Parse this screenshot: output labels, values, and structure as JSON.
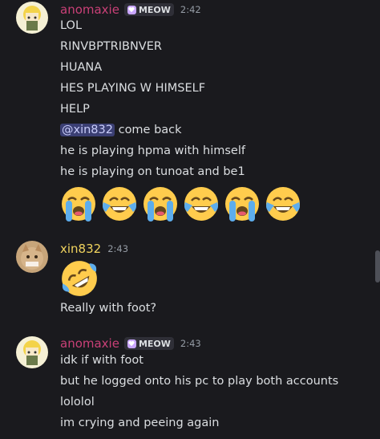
{
  "colors": {
    "anomaxie": "#c94077",
    "xin": "#f0d35e",
    "mention_bg": "#3b3f73"
  },
  "messages": [
    {
      "user": "anomaxie",
      "tag": "MEOW",
      "time": "2:42",
      "lines": [
        "LOL",
        "RINVBPTRIBNVER",
        "HUANA",
        "HES PLAYING W HIMSELF",
        "HELP"
      ],
      "mention": "@xin832",
      "mention_rest": " come back",
      "lines2": [
        "he is playing hpma with himself",
        "he is playing on tunoat and be1"
      ],
      "emoji": [
        "loudly-crying-face",
        "joy-face",
        "loudly-crying-face",
        "joy-face",
        "loudly-crying-face",
        "joy-face"
      ]
    },
    {
      "user": "xin832",
      "time": "2:43",
      "emoji": [
        "rolling-on-floor-laughing"
      ],
      "lines": [
        "Really with foot?"
      ]
    },
    {
      "user": "anomaxie",
      "tag": "MEOW",
      "time": "2:43",
      "lines": [
        "idk if with foot",
        "but he logged onto his pc to play both accounts",
        "lololol",
        "im crying and peeing again"
      ]
    }
  ]
}
